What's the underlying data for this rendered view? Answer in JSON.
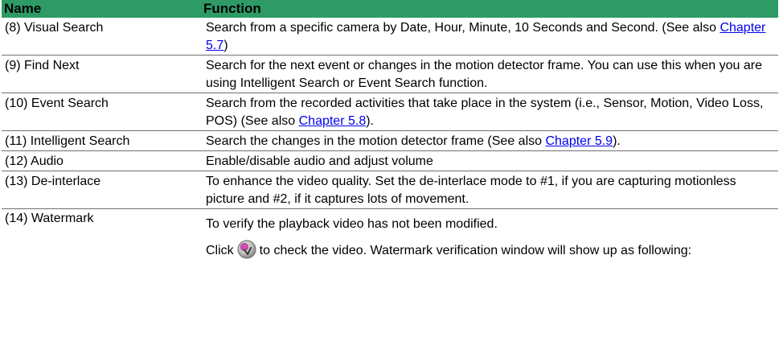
{
  "headers": {
    "name": "Name",
    "function": "Function"
  },
  "rows": [
    {
      "name": "(8) Visual Search",
      "desc_before": "Search from a specific camera by Date, Hour, Minute, 10 Seconds and Second. (See also ",
      "link": "Chapter 5.7",
      "desc_after": ")"
    },
    {
      "name": "(9) Find Next",
      "desc": "Search for the next event or changes in the motion detector frame. You can use this when you are using Intelligent Search or Event Search function."
    },
    {
      "name": "(10) Event Search",
      "desc_before": "Search from the recorded activities that take place in the system (i.e., Sensor, Motion, Video Loss, POS) (See also ",
      "link": "Chapter 5.8",
      "desc_after": ")."
    },
    {
      "name": "(11) Intelligent Search",
      "desc_before": "Search the changes in the motion detector frame (See also ",
      "link": "Chapter 5.9",
      "desc_after": ")."
    },
    {
      "name": "(12) Audio",
      "desc": "Enable/disable audio and adjust volume"
    },
    {
      "name": "(13) De-interlace",
      "desc": "To enhance the video quality. Set the de-interlace mode to #1, if you are capturing motionless picture and #2, if it captures lots of movement."
    },
    {
      "name": "(14) Watermark",
      "desc_line1": "To verify the playback video has not been modified.",
      "desc_click": "Click",
      "icon": "watermark-verify-icon",
      "desc_rest": "to check the video. Watermark verification window will show up as following:"
    }
  ],
  "colors": {
    "header_bg": "#2e9b67",
    "link": "#0000ee",
    "row_border": "#6f6f6f"
  }
}
